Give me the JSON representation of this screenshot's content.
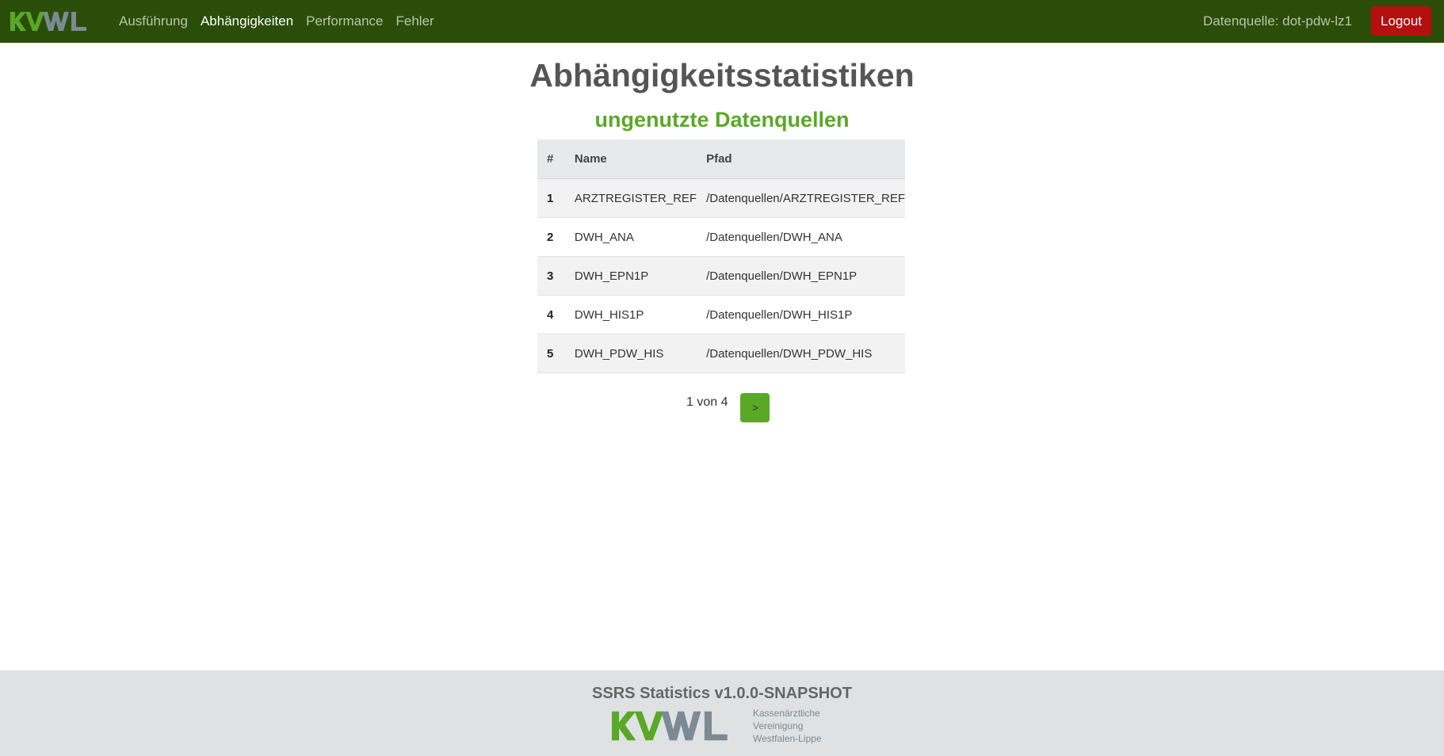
{
  "navbar": {
    "brand_logo_text": "KVWL",
    "links": [
      {
        "label": "Ausführung",
        "active": false
      },
      {
        "label": "Abhängigkeiten",
        "active": true
      },
      {
        "label": "Performance",
        "active": false
      },
      {
        "label": "Fehler",
        "active": false
      }
    ],
    "datasource_label": "Datenquelle: dot-pdw-lz1",
    "logout_label": "Logout"
  },
  "main": {
    "title": "Abhängigkeitsstatistiken",
    "subtitle": "ungenutzte Datenquellen",
    "table": {
      "headers": [
        "#",
        "Name",
        "Pfad"
      ],
      "rows": [
        {
          "num": "1",
          "name": "ARZTREGISTER_REF",
          "path": "/Datenquellen/ARZTREGISTER_REF"
        },
        {
          "num": "2",
          "name": "DWH_ANA",
          "path": "/Datenquellen/DWH_ANA"
        },
        {
          "num": "3",
          "name": "DWH_EPN1P",
          "path": "/Datenquellen/DWH_EPN1P"
        },
        {
          "num": "4",
          "name": "DWH_HIS1P",
          "path": "/Datenquellen/DWH_HIS1P"
        },
        {
          "num": "5",
          "name": "DWH_PDW_HIS",
          "path": "/Datenquellen/DWH_PDW_HIS"
        }
      ]
    },
    "pagination": {
      "info": "1 von 4",
      "next_label": ">"
    }
  },
  "footer": {
    "title": "SSRS Statistics v1.0.0-SNAPSHOT",
    "logo_text": "KVWL",
    "org_lines": [
      "Kassenärztliche",
      "Vereinigung",
      "Westfalen-Lippe"
    ]
  },
  "colors": {
    "navbar_bg": "#2b4d0a",
    "brand_green": "#5aa827",
    "brand_gray": "#7c8a93",
    "logout_bg": "#b50f0f",
    "footer_bg": "#dfe1e3"
  }
}
